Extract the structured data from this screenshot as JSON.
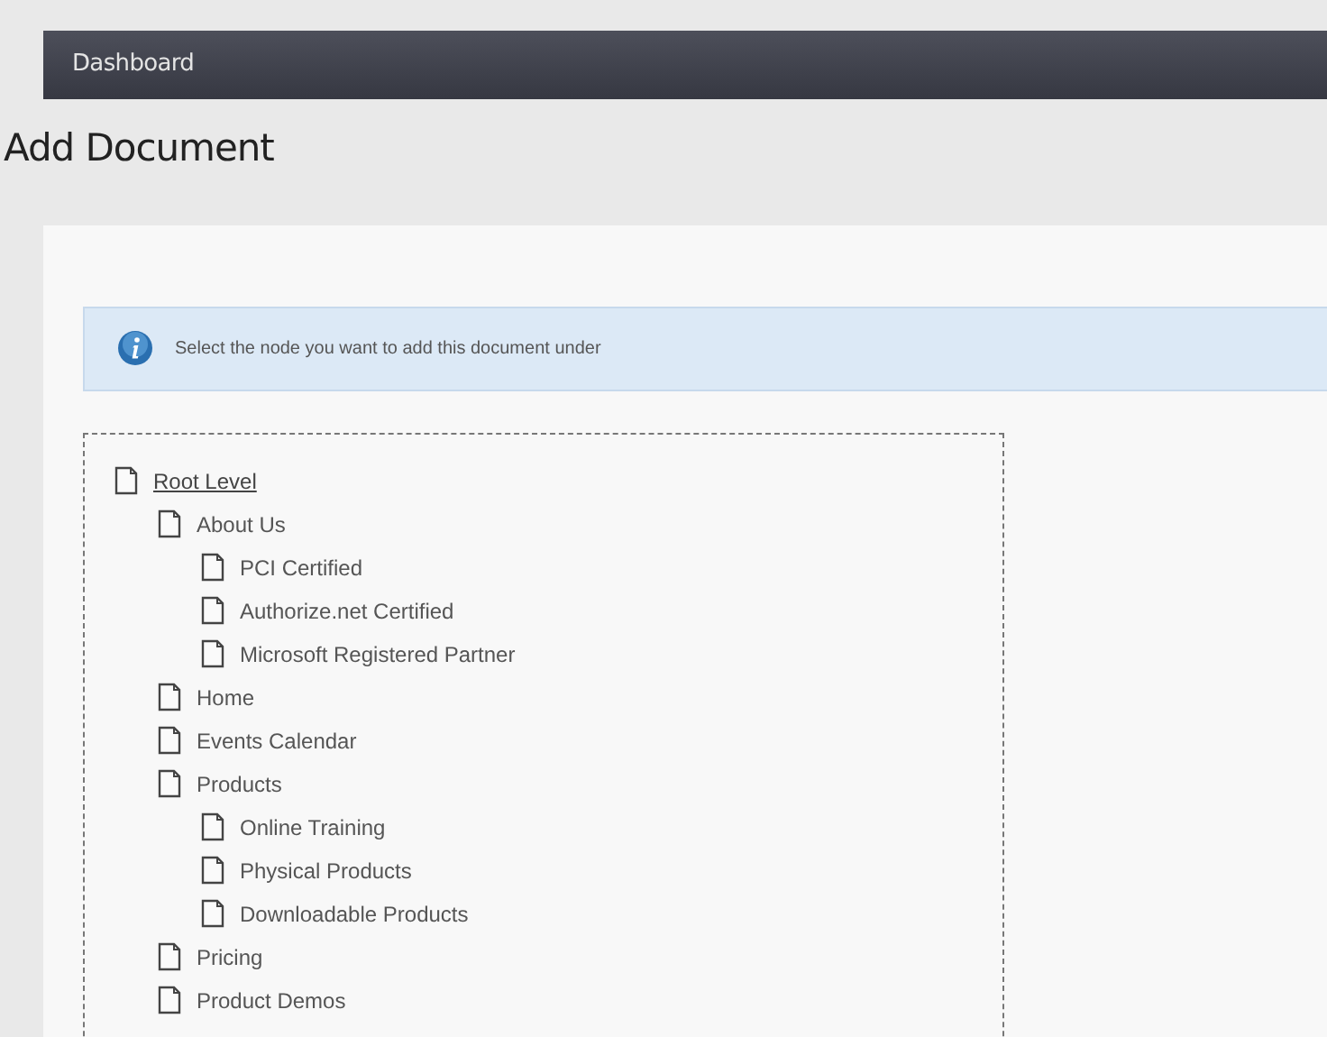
{
  "nav_bar": {
    "title": "Dashboard"
  },
  "heading": "Add Document",
  "info": {
    "message": "Select the node you want to add this document under"
  },
  "tree": [
    {
      "label": "Root Level",
      "children": [
        {
          "label": "About Us",
          "children": [
            {
              "label": "PCI Certified"
            },
            {
              "label": "Authorize.net Certified"
            },
            {
              "label": "Microsoft Registered Partner"
            }
          ]
        },
        {
          "label": "Home"
        },
        {
          "label": "Events Calendar"
        },
        {
          "label": "Products",
          "children": [
            {
              "label": "Online Training"
            },
            {
              "label": "Physical Products"
            },
            {
              "label": "Downloadable Products"
            }
          ]
        },
        {
          "label": "Pricing"
        },
        {
          "label": "Product Demos"
        }
      ]
    }
  ]
}
